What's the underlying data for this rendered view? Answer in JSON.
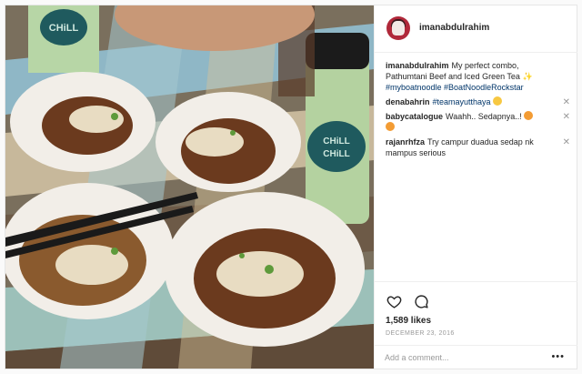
{
  "post": {
    "author": "imanabdulrahim",
    "avatar_color": "#b0283a",
    "photo_alt": "",
    "cups_brand": "CHiLL CHiLL",
    "caption": {
      "user": "imanabdulrahim",
      "text": "My perfect combo, Pathumtani Beef and Iced Green Tea",
      "hashtags": "#myboatnoodle #BoatNoodleRockstar"
    },
    "comments": [
      {
        "user": "denabahrin",
        "text": "#teamayutthaya",
        "emoji": "😀",
        "close": "✕"
      },
      {
        "user": "babycatalogue",
        "text": "Waahh.. Sedapnya..!",
        "emoji": "😍😍",
        "close": "✕"
      },
      {
        "user": "rajanrhfza",
        "text": "Try campur duadua sedap nk mampus serious",
        "close": "✕"
      }
    ],
    "likes": "1,589 likes",
    "date": "DECEMBER 23, 2016",
    "add_comment_placeholder": "Add a comment...",
    "more_label": "•••",
    "icons": {
      "like": "heart-icon",
      "comment": "comment-icon",
      "more": "more-options-icon"
    }
  }
}
